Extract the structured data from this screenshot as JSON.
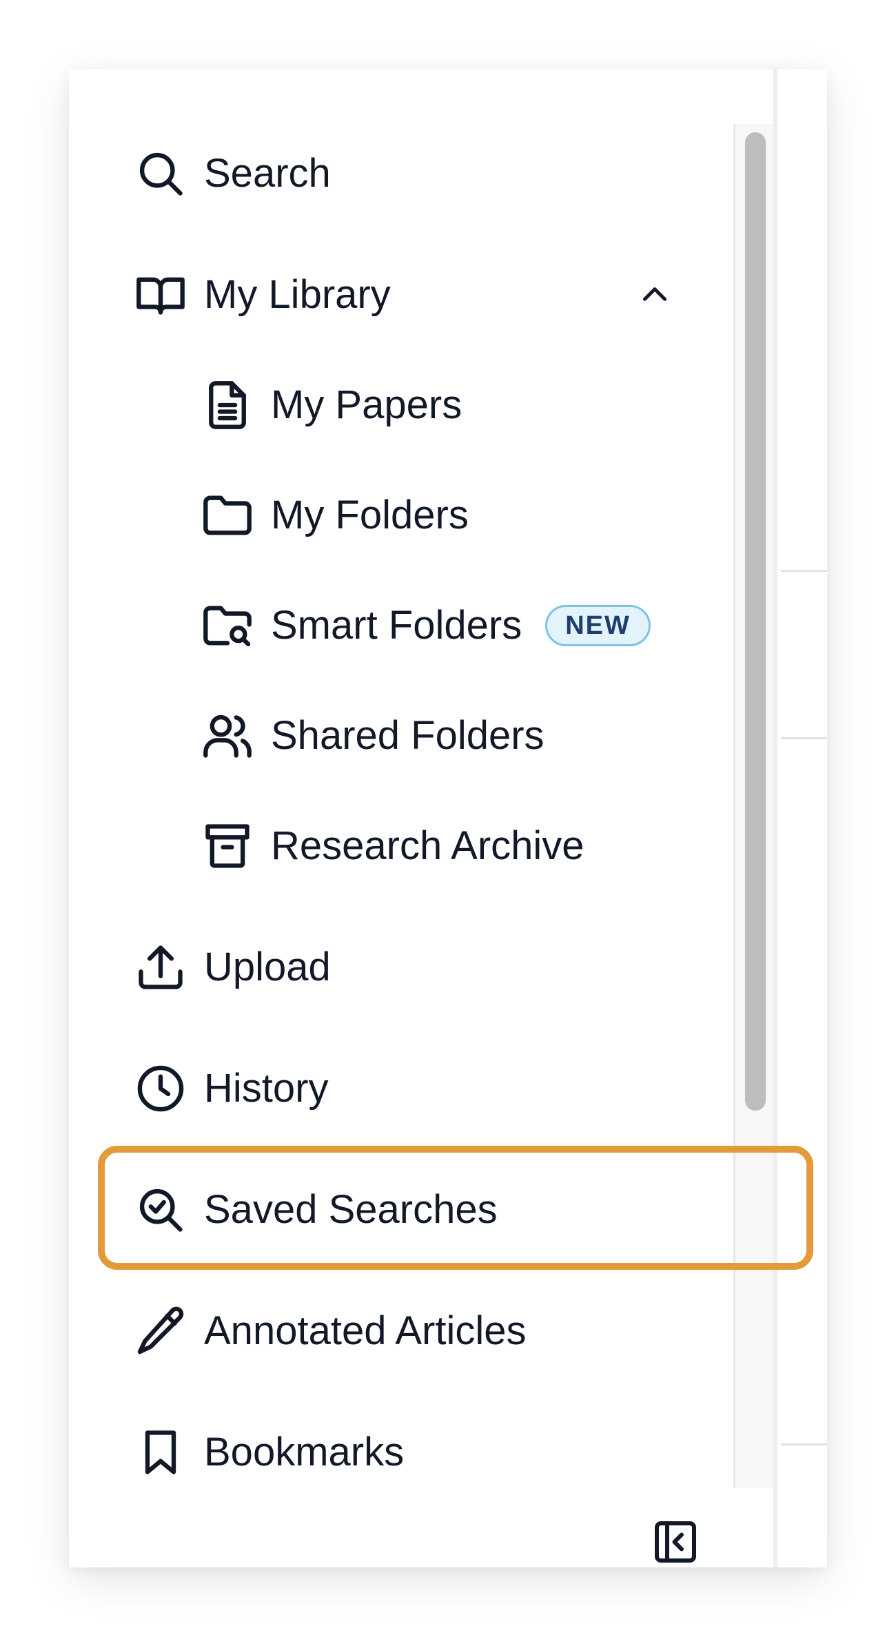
{
  "nav": {
    "search_label": "Search",
    "library_label": "My Library",
    "library_submenu": {
      "papers_label": "My Papers",
      "folders_label": "My Folders",
      "smart_folders_label": "Smart Folders",
      "smart_folders_badge": "NEW",
      "shared_folders_label": "Shared Folders",
      "archive_label": "Research Archive"
    },
    "upload_label": "Upload",
    "history_label": "History",
    "saved_searches_label": "Saved Searches",
    "annotated_label": "Annotated Articles",
    "bookmarks_label": "Bookmarks"
  },
  "icons": {
    "search": "search-icon",
    "library": "open-book-icon",
    "papers": "document-icon",
    "folders": "folder-icon",
    "smart_folders": "folder-search-icon",
    "shared_folders": "users-icon",
    "archive": "archive-box-icon",
    "upload": "upload-icon",
    "history": "clock-icon",
    "saved_searches": "search-check-icon",
    "annotated": "pencil-icon",
    "bookmarks": "bookmark-icon",
    "library_toggle": "chevron-up-icon",
    "collapse": "collapse-sidebar-icon"
  },
  "colors": {
    "highlight": "#e39a38",
    "badge_bg": "#e2f3fb",
    "badge_border": "#7cc3e6",
    "badge_text": "#1d3f6e",
    "text": "#111827"
  }
}
